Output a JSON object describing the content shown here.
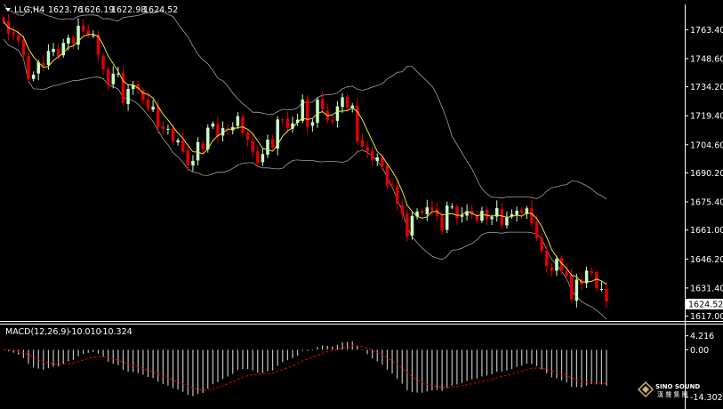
{
  "header": {
    "symbol": "LLG,H4",
    "open": "1623.76",
    "high": "1626.19",
    "low": "1622.98",
    "close": "1624.52"
  },
  "macd": {
    "label": "MACD(12,26,9)",
    "main": "-10.010",
    "signal": "-10.324",
    "ticks": [
      "4.216",
      "0.00",
      "-14.302"
    ],
    "tick_values": [
      4.216,
      0.0,
      -14.302
    ]
  },
  "current_price": "1624.52",
  "watermark": {
    "line1": "SINO SOUND",
    "line2": "漢 聲 集 團"
  },
  "colors": {
    "background": "#000000",
    "bull_candle": "#c8ffc8",
    "bear_candle": "#e00000",
    "ma_line": "#e8e830",
    "bands": "#a0a0a0",
    "macd_hist": "#c0c0c0",
    "macd_signal": "#e00000"
  },
  "chart_data": {
    "type": "candlestick",
    "y_ticks": [
      "1763.40",
      "1748.60",
      "1734.20",
      "1719.40",
      "1704.60",
      "1690.20",
      "1675.40",
      "1661.00",
      "1646.20",
      "1631.40",
      "1617.00"
    ],
    "y_tick_values": [
      1763.4,
      1748.6,
      1734.2,
      1719.4,
      1704.6,
      1690.2,
      1675.4,
      1661.0,
      1646.2,
      1631.4,
      1617.0
    ],
    "ylim": [
      1615.0,
      1774.0
    ],
    "macd_ylim": [
      -16.8,
      6.8
    ],
    "closes": [
      1767.5,
      1761.3,
      1760.9,
      1757.7,
      1750.5,
      1738.2,
      1740.4,
      1746.7,
      1745.1,
      1752.5,
      1753.6,
      1749.7,
      1756.6,
      1759.2,
      1756.3,
      1765.4,
      1762.6,
      1760.6,
      1760.5,
      1750.6,
      1743.2,
      1734.9,
      1740.9,
      1741.0,
      1726.0,
      1733.1,
      1735.1,
      1732.9,
      1727.3,
      1723.1,
      1724.1,
      1713.6,
      1712.7,
      1712.7,
      1706.4,
      1706.9,
      1701.0,
      1694.3,
      1696.3,
      1705.9,
      1702.2,
      1713.3,
      1715.4,
      1709.0,
      1713.1,
      1712.0,
      1713.6,
      1719.2,
      1710.5,
      1707.1,
      1701.1,
      1695.1,
      1699.8,
      1707.2,
      1703.2,
      1717.5,
      1717.1,
      1713.1,
      1715.5,
      1717.4,
      1727.7,
      1713.7,
      1716.1,
      1727.6,
      1722.6,
      1717.1,
      1716.2,
      1724.2,
      1728.8,
      1723.8,
      1724.6,
      1706.3,
      1703.8,
      1701.1,
      1696.9,
      1698.1,
      1693.7,
      1683.9,
      1682.9,
      1674.4,
      1669.4,
      1657.6,
      1668.2,
      1670.5,
      1669.7,
      1672.6,
      1671.3,
      1668.3,
      1660.8,
      1673.5,
      1673.0,
      1667.2,
      1668.7,
      1670.6,
      1668.8,
      1665.8,
      1670.8,
      1666.9,
      1667.6,
      1672.3,
      1663.4,
      1667.4,
      1669.1,
      1670.9,
      1669.8,
      1672.1,
      1664.6,
      1657.0,
      1650.3,
      1642.6,
      1640.2,
      1646.2,
      1640.5,
      1637.6,
      1625.5,
      1635.7,
      1633.3,
      1640.3,
      1639.2,
      1631.4,
      1630.9,
      1624.5
    ]
  }
}
